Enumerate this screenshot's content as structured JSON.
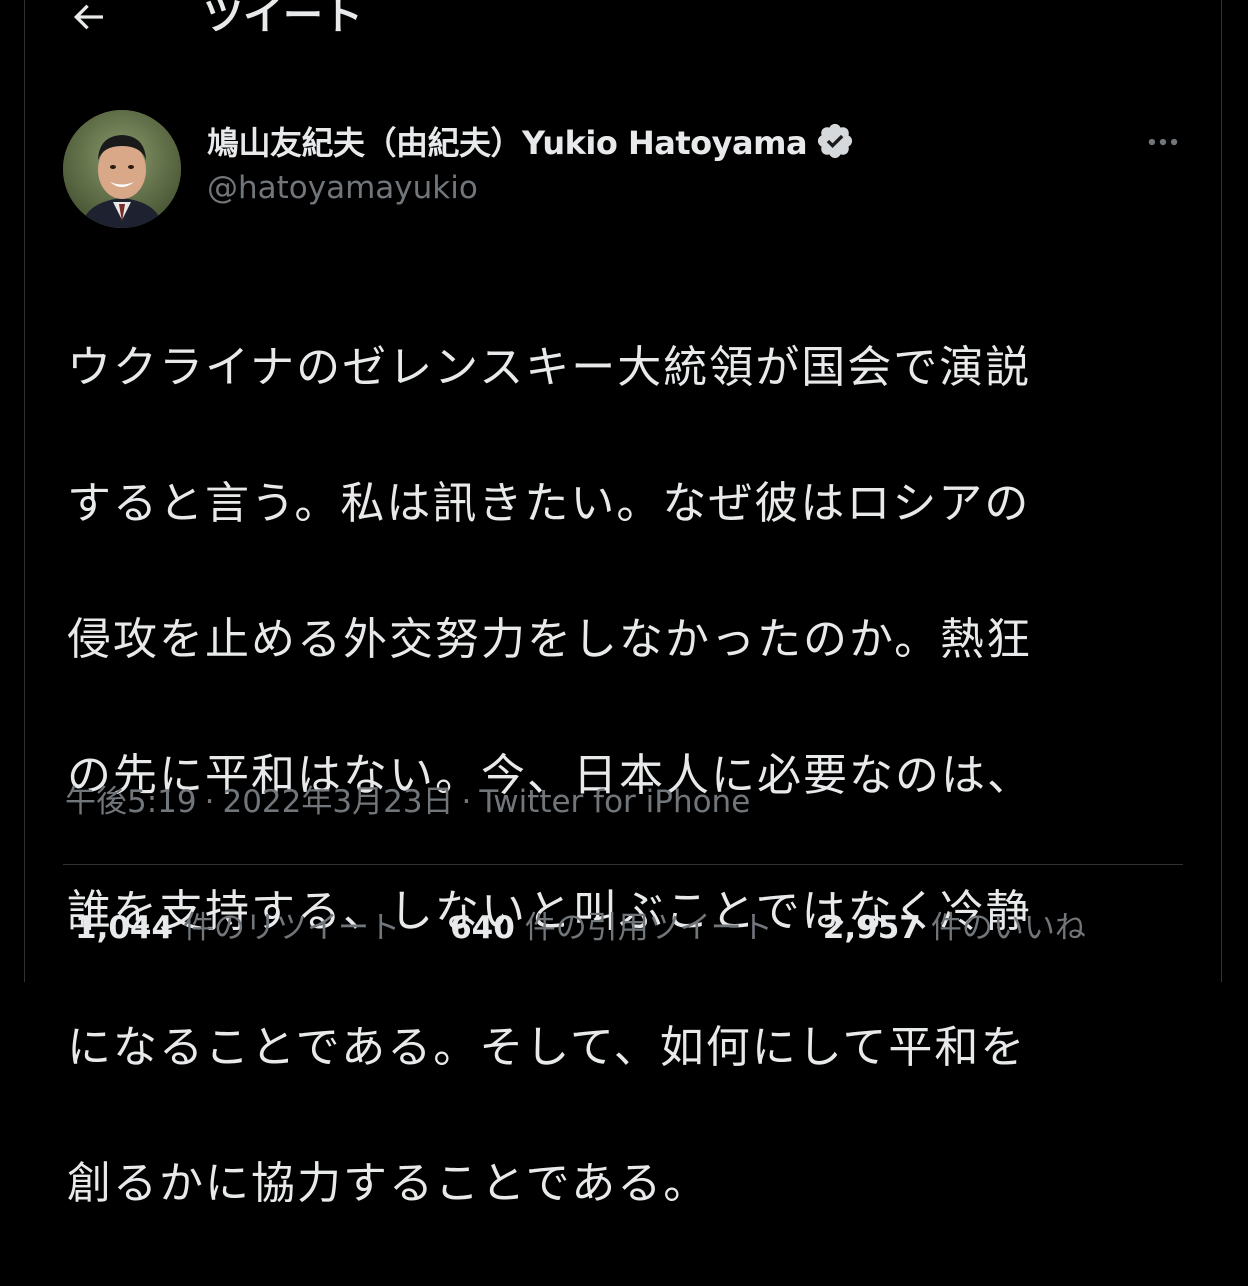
{
  "header": {
    "title": "ツイート"
  },
  "tweet": {
    "display_name": "鳩山友紀夫（由紀夫）Yukio Hatoyama",
    "handle": "@hatoyamayukio",
    "text_lines": [
      "ウクライナのゼレンスキー大統領が国会で演説",
      "すると言う。私は訊きたい。なぜ彼はロシアの",
      "侵攻を止める外交努力をしなかったのか。熱狂",
      "の先に平和はない。今、日本人に必要なのは、",
      "誰を支持する、しないと叫ぶことではなく冷静",
      "になることである。そして、如何にして平和を",
      "創るかに協力することである。"
    ],
    "time": "午後5:19",
    "date": "2022年3月23日",
    "source": "Twitter for iPhone",
    "separator": "·"
  },
  "stats": {
    "retweets": {
      "count": "1,044",
      "label": "件のリツイート"
    },
    "quotes": {
      "count": "640",
      "label": "件の引用ツイート"
    },
    "likes": {
      "count": "2,957",
      "label": "件のいいね"
    }
  },
  "icons": {
    "back": "arrow-left-icon",
    "verified": "verified-badge-icon",
    "more": "more-horizontal-icon"
  },
  "colors": {
    "background": "#000000",
    "text_primary": "#e7e9ea",
    "text_secondary": "#71767b",
    "border": "#2f3336"
  }
}
